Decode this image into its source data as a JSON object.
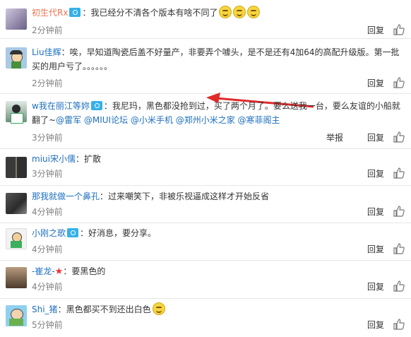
{
  "comments": [
    {
      "user": "初生代Rx",
      "text": "：我已经分不清各个版本有啥不同了",
      "time": "2分钟前",
      "reply": "回复"
    },
    {
      "user": "Liu佳辉",
      "text": "：唉，早知道陶瓷后盖不好量产，非要弄个噱头，是不是还有4加64的高配升级版。第一批买的用户亏了。。。。。。",
      "time": "2分钟前",
      "reply": "回复"
    },
    {
      "user": "w我在丽江等妳",
      "text": "：我尼玛，黑色都没抢到过，买了两个月了。要么送我一台，要么友谊的小船就翻了~",
      "mentions": "@雷军 @MIUI论坛 @小米手机 @郑州小米之家 @寒菲阁主",
      "time": "3分钟前",
      "report": "举报",
      "reply": "回复"
    },
    {
      "user": "miui宋小儒",
      "text": "：扩散",
      "time": "3分钟前",
      "reply": "回复"
    },
    {
      "user": "那我就做一个鼻孔",
      "text": "：过来嘲笑下，非被乐视逼成这样才开始反省",
      "time": "4分钟前",
      "reply": "回复"
    },
    {
      "user": "小刚之歌",
      "text": "：好消息，要分享。",
      "time": "4分钟前",
      "reply": "回复"
    },
    {
      "user": "-崔龙-",
      "text": "：要黑色的",
      "time": "4分钟前",
      "reply": "回复"
    },
    {
      "user": "Shi_猪",
      "text": "：黑色都买不到还出白色",
      "time": "5分钟前",
      "reply": "回复"
    }
  ]
}
